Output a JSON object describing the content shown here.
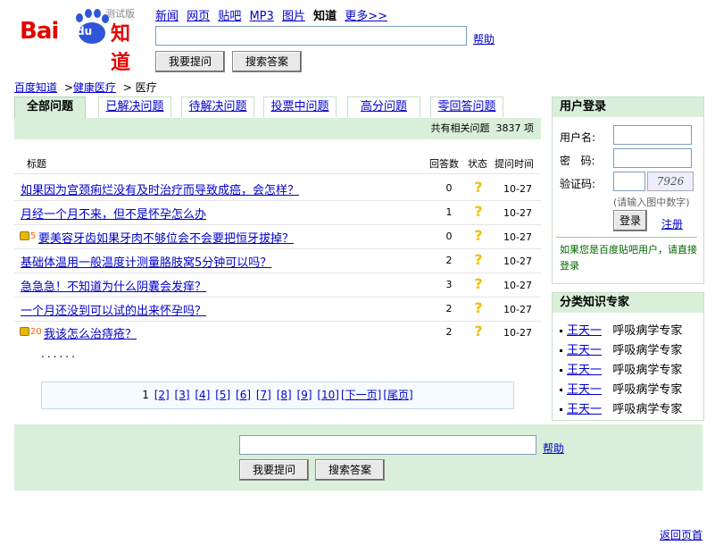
{
  "logo": {
    "bai": "Bai",
    "du": "du",
    "zhidao": "知道",
    "beta": "测试版"
  },
  "topnav": [
    {
      "label": "新闻",
      "link": true
    },
    {
      "label": "网页",
      "link": true
    },
    {
      "label": "贴吧",
      "link": true
    },
    {
      "label": "MP3",
      "link": true
    },
    {
      "label": "图片",
      "link": true
    },
    {
      "label": "知道",
      "link": false
    },
    {
      "label": "更多>>",
      "link": true
    }
  ],
  "search": {
    "value": "",
    "help": "帮助",
    "ask_button": "我要提问",
    "search_button": "搜索答案"
  },
  "breadcrumb": {
    "home": "百度知道",
    "cat": "健康医疗",
    "sep1": ">",
    "sep2": ">",
    "current": "医疗"
  },
  "tabs": [
    "全部问题",
    "已解决问题",
    "待解决问题",
    "投票中问题",
    "高分问题",
    "零回答问题"
  ],
  "count_text": "共有相关问题  3837 项",
  "table": {
    "headers": {
      "title": "标题",
      "answers": "回答数",
      "status": "状态",
      "time": "提问时间"
    },
    "rows": [
      {
        "reward": "",
        "title": "如果因为宫颈痢烂没有及时治疗而导致成癌，会怎样？",
        "answers": "0",
        "status": "?",
        "time": "10-27"
      },
      {
        "reward": "",
        "title": "月经一个月不来，但不是怀孕怎么办",
        "answers": "1",
        "status": "?",
        "time": "10-27"
      },
      {
        "reward": "5",
        "title": "要美容牙齿如果牙肉不够位会不会要把恒牙拔掉？",
        "answers": "0",
        "status": "?",
        "time": "10-27"
      },
      {
        "reward": "",
        "title": "基础体温用一般温度计测量胳肢窝5分钟可以吗？",
        "answers": "2",
        "status": "?",
        "time": "10-27"
      },
      {
        "reward": "",
        "title": "急急急！不知道为什么阴囊会发痒？",
        "answers": "3",
        "status": "?",
        "time": "10-27"
      },
      {
        "reward": "",
        "title": "一个月还没到可以试的出来怀孕吗？",
        "answers": "2",
        "status": "?",
        "time": "10-27"
      },
      {
        "reward": "20",
        "title": "我该怎么治痔疮？",
        "answers": "2",
        "status": "?",
        "time": "10-27"
      }
    ]
  },
  "dots": "......",
  "pager": {
    "current": "1",
    "pages": [
      "[2]",
      "[3]",
      "[4]",
      "[5]",
      "[6]",
      "[7]",
      "[8]",
      "[9]",
      "[10]"
    ],
    "next": "[下一页]",
    "last": "[尾页]"
  },
  "login": {
    "title": "用户登录",
    "username_label": "用户名:",
    "password_label": "密   码:",
    "captcha_label": "验证码:",
    "captcha_text": "7926",
    "captcha_hint": "(请输入图中数字)",
    "login_button": "登录",
    "register": "注册",
    "note": "如果您是百度贴吧用户，请直接登录"
  },
  "experts": {
    "title": "分类知识专家",
    "items": [
      {
        "name": "王天一",
        "desc": "呼吸病学专家"
      },
      {
        "name": "王天一",
        "desc": "呼吸病学专家"
      },
      {
        "name": "王天一",
        "desc": "呼吸病学专家"
      },
      {
        "name": "王天一",
        "desc": "呼吸病学专家"
      },
      {
        "name": "王天一",
        "desc": "呼吸病学专家"
      }
    ]
  },
  "back_to_top": "返回页首",
  "colors": {
    "brand_red": "#e10602",
    "panel_green": "#d9efd9",
    "link_blue": "#0000cc",
    "status_yellow": "#f0c000"
  }
}
